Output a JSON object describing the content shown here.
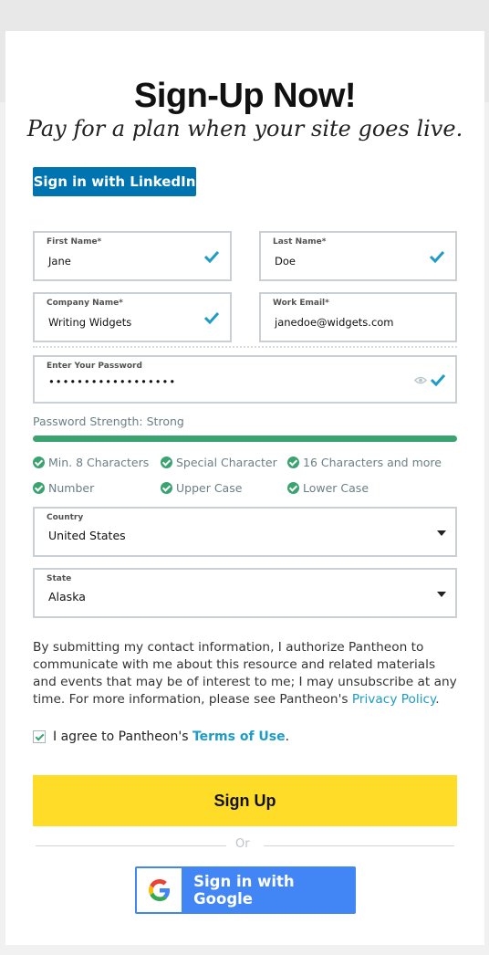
{
  "header": {
    "title": "Sign-Up Now!",
    "subtitle": "Pay for a plan when your site goes live."
  },
  "linkedin_button": "Sign in with LinkedIn",
  "fields": {
    "first_name": {
      "label": "First Name*",
      "value": "Jane"
    },
    "last_name": {
      "label": "Last Name*",
      "value": "Doe"
    },
    "company": {
      "label": "Company Name*",
      "value": "Writing Widgets"
    },
    "work_email": {
      "label": "Work Email*",
      "value": "janedoe@widgets.com"
    },
    "password": {
      "label": "Enter Your Password",
      "value": "••••••••••••••••••"
    },
    "country": {
      "label": "Country",
      "value": "United States"
    },
    "state": {
      "label": "State",
      "value": "Alaska"
    }
  },
  "password_strength": {
    "label": "Password Strength: Strong",
    "level": 1.0,
    "rules": [
      "Min. 8 Characters",
      "Special Character",
      "16 Characters and more",
      "Number",
      "Upper Case",
      "Lower Case"
    ]
  },
  "consent": {
    "text": "By submitting my contact information, I authorize Pantheon to communicate with me about this resource and related materials and events that may be of interest to me; I may unsubscribe at any time. For more information, please see Pantheon's ",
    "link": "Privacy Policy",
    "end": "."
  },
  "agree": {
    "prefix": "I agree to Pantheon's ",
    "link": "Terms of Use",
    "suffix": ".",
    "checked": true
  },
  "signup_button": "Sign Up",
  "or_label": "Or",
  "google_button": "Sign in with Google",
  "colors": {
    "linkedin": "#0073b1",
    "accent_green": "#3aa370",
    "signup_yellow": "#ffdc28",
    "google_blue": "#4285f4",
    "link": "#1e9bc6"
  }
}
